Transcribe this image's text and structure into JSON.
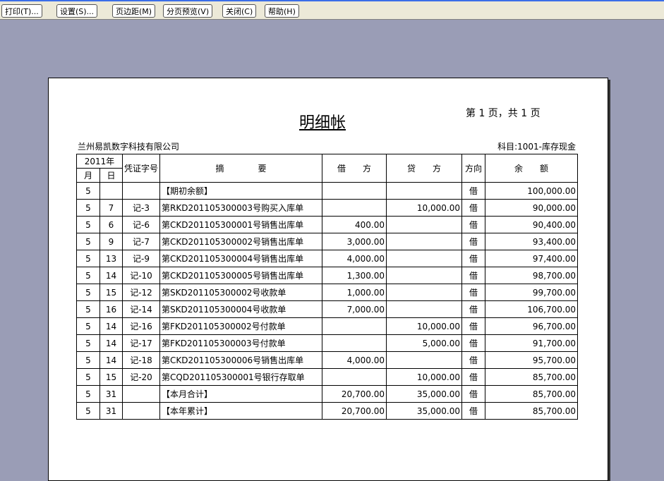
{
  "toolbar": [
    "打印(T)...",
    "设置(S)...",
    "页边距(M)",
    "分页预览(V)",
    "关闭(C)",
    "帮助(H)"
  ],
  "report": {
    "title": "明细帐",
    "page_info": "第 1 页，共 1 页",
    "company": "兰州易凯数字科技有限公司",
    "subject": "科目:1001-库存现金"
  },
  "headers": {
    "year": "2011年",
    "month": "月",
    "day": "日",
    "voucher": "凭证字号",
    "summary": "摘　　　　要",
    "debit": "借　　方",
    "credit": "贷　　方",
    "direction": "方向",
    "balance": "余　　额"
  },
  "rows": [
    [
      "5",
      "",
      "",
      "【期初余额】",
      "",
      "",
      "借",
      "100,000.00"
    ],
    [
      "5",
      "7",
      "记-3",
      "第RKD201105300003号购买入库单",
      "",
      "10,000.00",
      "借",
      "90,000.00"
    ],
    [
      "5",
      "6",
      "记-6",
      "第CKD201105300001号销售出库单",
      "400.00",
      "",
      "借",
      "90,400.00"
    ],
    [
      "5",
      "9",
      "记-7",
      "第CKD201105300002号销售出库单",
      "3,000.00",
      "",
      "借",
      "93,400.00"
    ],
    [
      "5",
      "13",
      "记-9",
      "第CKD201105300004号销售出库单",
      "4,000.00",
      "",
      "借",
      "97,400.00"
    ],
    [
      "5",
      "14",
      "记-10",
      "第CKD201105300005号销售出库单",
      "1,300.00",
      "",
      "借",
      "98,700.00"
    ],
    [
      "5",
      "15",
      "记-12",
      "第SKD201105300002号收款单",
      "1,000.00",
      "",
      "借",
      "99,700.00"
    ],
    [
      "5",
      "16",
      "记-14",
      "第SKD201105300004号收款单",
      "7,000.00",
      "",
      "借",
      "106,700.00"
    ],
    [
      "5",
      "14",
      "记-16",
      "第FKD201105300002号付款单",
      "",
      "10,000.00",
      "借",
      "96,700.00"
    ],
    [
      "5",
      "14",
      "记-17",
      "第FKD201105300003号付款单",
      "",
      "5,000.00",
      "借",
      "91,700.00"
    ],
    [
      "5",
      "14",
      "记-18",
      "第CKD201105300006号销售出库单",
      "4,000.00",
      "",
      "借",
      "95,700.00"
    ],
    [
      "5",
      "15",
      "记-20",
      "第CQD201105300001号银行存取单",
      "",
      "10,000.00",
      "借",
      "85,700.00"
    ],
    [
      "5",
      "31",
      "",
      "【本月合计】",
      "20,700.00",
      "35,000.00",
      "借",
      "85,700.00"
    ],
    [
      "5",
      "31",
      "",
      "【本年累计】",
      "20,700.00",
      "35,000.00",
      "借",
      "85,700.00"
    ]
  ]
}
